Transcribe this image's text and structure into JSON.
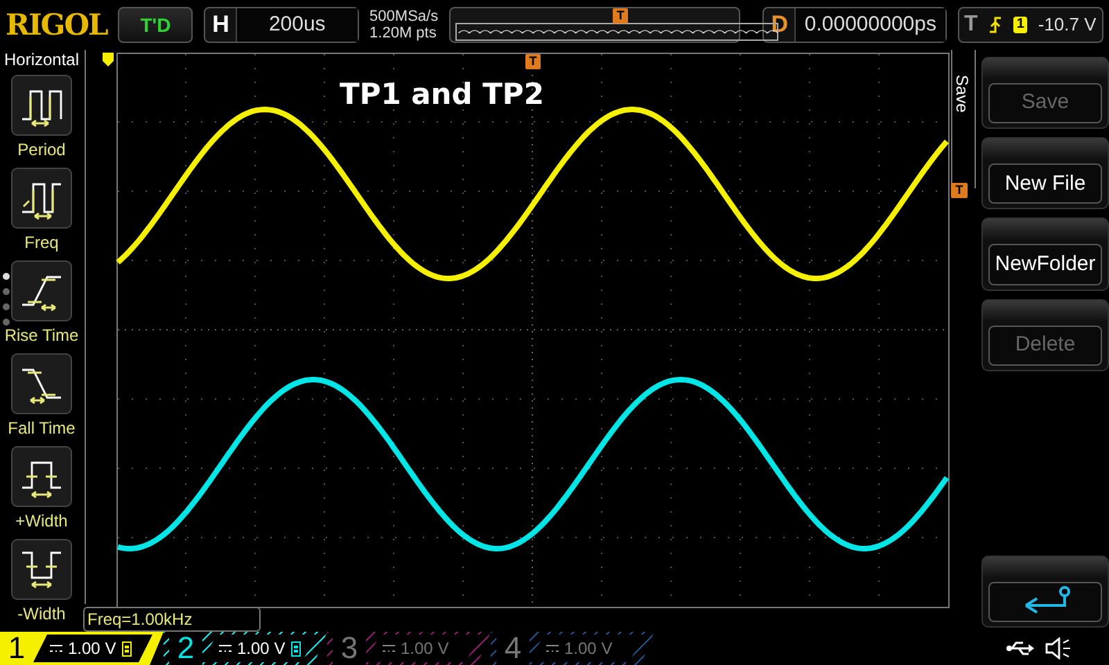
{
  "top_bar": {
    "logo": "RIGOL",
    "run_status": "T'D",
    "horizontal": {
      "label": "H",
      "timebase": "200us"
    },
    "sample_rate": "500MSa/s",
    "memory_depth": "1.20M pts",
    "memory_marker": "T",
    "delay": {
      "label": "D",
      "value": "0.00000000ps"
    },
    "trigger": {
      "label": "T",
      "source": "1",
      "level": "-10.7 V"
    }
  },
  "measure_panel": {
    "title": "Horizontal",
    "pages": [
      {
        "selected": true
      },
      {
        "selected": false
      },
      {
        "selected": false
      },
      {
        "selected": false
      }
    ],
    "items": [
      {
        "kind": "period",
        "label": "Period"
      },
      {
        "kind": "freq",
        "label": "Freq"
      },
      {
        "kind": "rise",
        "label": "Rise Time"
      },
      {
        "kind": "fall",
        "label": "Fall Time"
      },
      {
        "kind": "pwidth",
        "label": "+Width"
      },
      {
        "kind": "nwidth",
        "label": "-Width"
      }
    ]
  },
  "plot": {
    "title": "TP1 and TP2",
    "trigger_position_marker": "T",
    "trigger_level_marker": "T",
    "readout": "Freq=1.00kHz"
  },
  "menu": {
    "title": "Save",
    "buttons": [
      {
        "kind": "text",
        "label": "Save",
        "disabled": true
      },
      {
        "kind": "text",
        "label": "New File",
        "disabled": false
      },
      {
        "kind": "text",
        "label": "NewFolder",
        "disabled": false
      },
      {
        "kind": "text",
        "label": "Delete",
        "disabled": true
      },
      {
        "kind": "back"
      }
    ]
  },
  "channels": [
    {
      "number": "1",
      "scale": "1.00 V",
      "on": true,
      "selected": true,
      "color": "#f5f000"
    },
    {
      "number": "2",
      "scale": "1.00 V",
      "on": true,
      "selected": false,
      "color": "#00e6e6"
    },
    {
      "number": "3",
      "scale": "1.00 V",
      "on": false,
      "selected": false,
      "color": "#8a1a6a"
    },
    {
      "number": "4",
      "scale": "1.00 V",
      "on": false,
      "selected": false,
      "color": "#1e4f86"
    }
  ]
}
